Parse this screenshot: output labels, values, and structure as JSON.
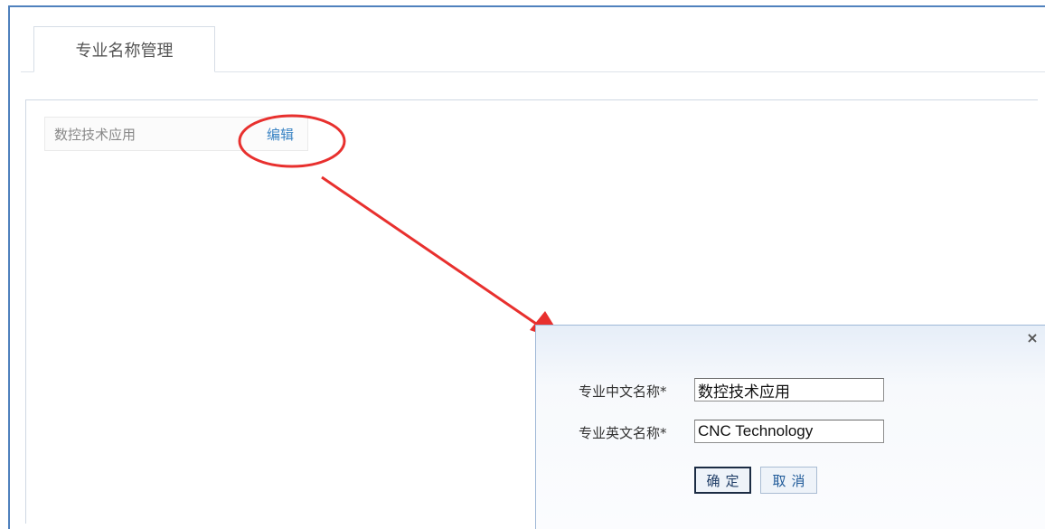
{
  "tab": {
    "label": "专业名称管理"
  },
  "majors": [
    {
      "name": "数控技术应用",
      "edit_label": "编辑"
    }
  ],
  "dialog": {
    "close_icon": "×",
    "fields": [
      {
        "label": "专业中文名称*",
        "value": "数控技术应用"
      },
      {
        "label": "专业英文名称*",
        "value": "CNC Technology"
      }
    ],
    "confirm_label": "确定",
    "cancel_label": "取消"
  },
  "colors": {
    "frame_border": "#4f81bd",
    "annotation_red": "#e8302e",
    "link_blue": "#3b84c4"
  }
}
